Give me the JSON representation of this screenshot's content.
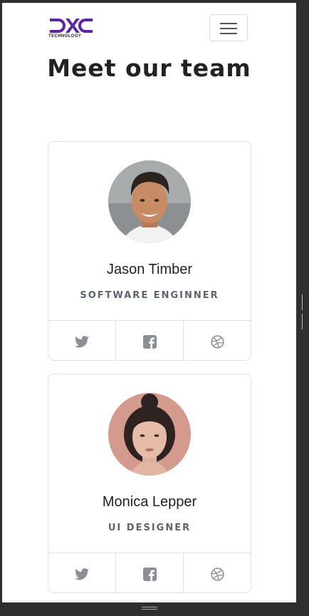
{
  "brand": {
    "logo_text": "DXC",
    "logo_subtext": "TECHNOLOGY",
    "color": "#5f249f"
  },
  "page": {
    "title": "Meet our team"
  },
  "team": [
    {
      "name": "Jason Timber",
      "role": "SOFTWARE ENGINNER",
      "socials": [
        "twitter-icon",
        "facebook-icon",
        "dribbble-icon"
      ]
    },
    {
      "name": "Monica Lepper",
      "role": "UI DESIGNER",
      "socials": [
        "twitter-icon",
        "facebook-icon",
        "dribbble-icon"
      ]
    }
  ],
  "colors": {
    "icon": "#8a8f96",
    "border": "#e2e2e2"
  }
}
